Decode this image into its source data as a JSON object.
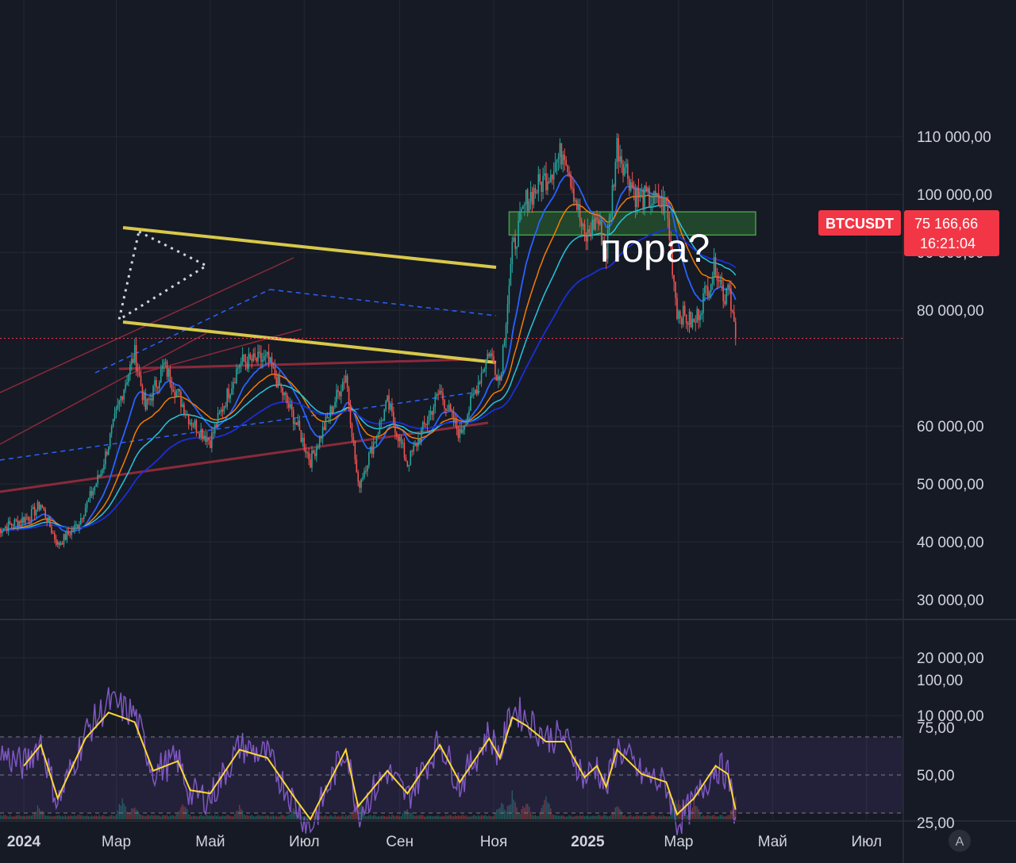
{
  "chart_data": {
    "type": "line",
    "symbol": "BTCUSDT",
    "last_price_label": "75 166,66",
    "countdown_label": "16:21:04",
    "annotation": "пора?",
    "colors": {
      "background": "#161a25",
      "grid": "#242833",
      "up": "#26a69a",
      "down": "#ef5350",
      "ema_fast": "#2962ff",
      "ema_mid": "#f57c00",
      "ema_slow": "#26c6da",
      "ema_long": "#1a2fd6",
      "channel": "#d8c84a",
      "support": "#8a2a3a",
      "resistance_zone": "#2e7d32",
      "rsi": "#7e57c2",
      "rsi_ma": "#fdd835",
      "price_tag": "#f23645"
    },
    "price_axis": {
      "ticks": [
        10000,
        20000,
        30000,
        40000,
        50000,
        60000,
        70000,
        80000,
        90000,
        100000,
        110000
      ],
      "tick_labels": [
        "10 000,00",
        "20 000,00",
        "30 000,00",
        "40 000,00",
        "50 000,00",
        "60 000,00",
        "70 000,00",
        "80 000,00",
        "90 000,00",
        "100 000,00",
        "110 000,00"
      ],
      "range": [
        0,
        112000
      ]
    },
    "time_axis": {
      "labels": [
        "2024",
        "Мар",
        "Май",
        "Июл",
        "Сен",
        "Ноя",
        "2025",
        "Мар",
        "Май",
        "Июл"
      ],
      "bold": [
        true,
        false,
        false,
        false,
        false,
        false,
        true,
        false,
        false,
        false
      ]
    },
    "last_price": 75166.66,
    "resistance_zone": {
      "from_date": "2024-11-11",
      "to_date": "2025-04-20",
      "low": 93000,
      "high": 97000
    },
    "price_series": {
      "name": "",
      "points": [
        [
          "2023-12-15",
          42000
        ],
        [
          "2024-01-05",
          44500
        ],
        [
          "2024-01-12",
          46500
        ],
        [
          "2024-01-23",
          39500
        ],
        [
          "2024-02-05",
          43000
        ],
        [
          "2024-02-20",
          52000
        ],
        [
          "2024-03-05",
          66000
        ],
        [
          "2024-03-13",
          72500
        ],
        [
          "2024-03-20",
          63000
        ],
        [
          "2024-04-01",
          70500
        ],
        [
          "2024-04-18",
          61000
        ],
        [
          "2024-05-01",
          57500
        ],
        [
          "2024-05-20",
          71000
        ],
        [
          "2024-06-07",
          71500
        ],
        [
          "2024-06-25",
          61000
        ],
        [
          "2024-07-05",
          54000
        ],
        [
          "2024-07-28",
          69000
        ],
        [
          "2024-08-05",
          49500
        ],
        [
          "2024-08-24",
          64000
        ],
        [
          "2024-09-06",
          53500
        ],
        [
          "2024-09-27",
          66000
        ],
        [
          "2024-10-10",
          58500
        ],
        [
          "2024-10-29",
          73000
        ],
        [
          "2024-11-05",
          68000
        ],
        [
          "2024-11-13",
          90000
        ],
        [
          "2024-11-22",
          99000
        ],
        [
          "2024-12-05",
          103000
        ],
        [
          "2024-12-17",
          108000
        ],
        [
          "2024-12-30",
          92000
        ],
        [
          "2025-01-07",
          96000
        ],
        [
          "2025-01-13",
          90000
        ],
        [
          "2025-01-20",
          108500
        ],
        [
          "2025-02-01",
          100000
        ],
        [
          "2025-02-21",
          98000
        ],
        [
          "2025-02-28",
          80000
        ],
        [
          "2025-03-11",
          77500
        ],
        [
          "2025-03-25",
          88000
        ],
        [
          "2025-03-31",
          82000
        ],
        [
          "2025-04-02",
          86000
        ],
        [
          "2025-04-07",
          75166.66
        ]
      ]
    },
    "rsi": {
      "axis_ticks": [
        25,
        50,
        75,
        100
      ],
      "axis_labels": [
        "25,00",
        "50,00",
        "75,00",
        "100,00"
      ],
      "bands": [
        30,
        50,
        70
      ],
      "range": [
        10,
        105
      ],
      "points": [
        [
          "2023-12-15",
          62
        ],
        [
          "2024-01-01",
          55
        ],
        [
          "2024-01-12",
          68
        ],
        [
          "2024-01-23",
          35
        ],
        [
          "2024-02-10",
          72
        ],
        [
          "2024-02-25",
          88
        ],
        [
          "2024-03-05",
          85
        ],
        [
          "2024-03-13",
          82
        ],
        [
          "2024-03-25",
          52
        ],
        [
          "2024-04-10",
          58
        ],
        [
          "2024-04-18",
          40
        ],
        [
          "2024-05-01",
          38
        ],
        [
          "2024-05-20",
          65
        ],
        [
          "2024-06-07",
          60
        ],
        [
          "2024-06-25",
          35
        ],
        [
          "2024-07-05",
          22
        ],
        [
          "2024-07-28",
          65
        ],
        [
          "2024-08-05",
          30
        ],
        [
          "2024-08-24",
          52
        ],
        [
          "2024-09-06",
          38
        ],
        [
          "2024-09-27",
          68
        ],
        [
          "2024-10-10",
          45
        ],
        [
          "2024-10-29",
          72
        ],
        [
          "2024-11-05",
          60
        ],
        [
          "2024-11-13",
          85
        ],
        [
          "2024-11-22",
          80
        ],
        [
          "2024-12-05",
          70
        ],
        [
          "2024-12-17",
          70
        ],
        [
          "2024-12-30",
          48
        ],
        [
          "2025-01-07",
          55
        ],
        [
          "2025-01-13",
          42
        ],
        [
          "2025-01-20",
          65
        ],
        [
          "2025-02-05",
          50
        ],
        [
          "2025-02-21",
          45
        ],
        [
          "2025-02-28",
          25
        ],
        [
          "2025-03-11",
          35
        ],
        [
          "2025-03-25",
          55
        ],
        [
          "2025-04-02",
          50
        ],
        [
          "2025-04-07",
          28
        ]
      ]
    },
    "volume": {
      "points": [
        [
          "2024-01-11",
          0.55
        ],
        [
          "2024-03-05",
          0.8
        ],
        [
          "2024-03-13",
          0.6
        ],
        [
          "2024-04-13",
          0.7
        ],
        [
          "2024-05-20",
          0.5
        ],
        [
          "2024-06-25",
          0.5
        ],
        [
          "2024-08-05",
          0.9
        ],
        [
          "2024-09-06",
          0.45
        ],
        [
          "2024-11-06",
          0.7
        ],
        [
          "2024-11-13",
          1.0
        ],
        [
          "2024-11-22",
          0.7
        ],
        [
          "2024-12-05",
          0.8
        ],
        [
          "2025-01-20",
          0.6
        ],
        [
          "2025-02-28",
          0.85
        ],
        [
          "2025-03-11",
          0.7
        ],
        [
          "2025-04-07",
          0.75
        ]
      ]
    }
  },
  "toolbar": {
    "auto_label": "A"
  }
}
